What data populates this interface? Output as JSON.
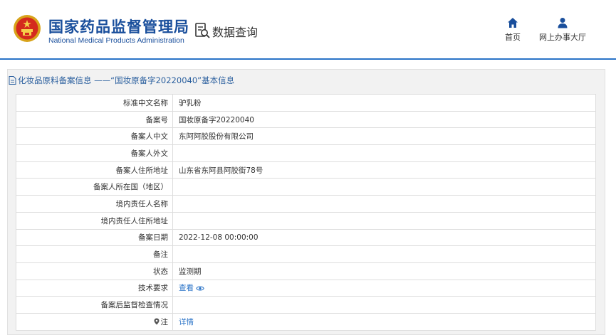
{
  "header": {
    "brand_cn": "国家药品监督管理局",
    "brand_en": "National Medical Products Administration",
    "query_label": "数据查询",
    "nav": [
      {
        "label": "首页",
        "icon": "home-icon"
      },
      {
        "label": "网上办事大厅",
        "icon": "user-icon"
      }
    ],
    "accent_color": "#2a73c7"
  },
  "panel": {
    "title": "化妆品原料备案信息 ——“国妆原备字20220040”基本信息",
    "rows": [
      {
        "label": "标准中文名称",
        "value": "驴乳粉"
      },
      {
        "label": "备案号",
        "value": "国妆原备字20220040"
      },
      {
        "label": "备案人中文",
        "value": "东阿阿胶股份有限公司"
      },
      {
        "label": "备案人外文",
        "value": ""
      },
      {
        "label": "备案人住所地址",
        "value": "山东省东阿县阿胶街78号"
      },
      {
        "label": "备案人所在国（地区）",
        "value": ""
      },
      {
        "label": "境内责任人名称",
        "value": ""
      },
      {
        "label": "境内责任人住所地址",
        "value": ""
      },
      {
        "label": "备案日期",
        "value": "2022-12-08 00:00:00"
      },
      {
        "label": "备注",
        "value": ""
      },
      {
        "label": "状态",
        "value": "监测期"
      },
      {
        "label": "技术要求",
        "value": "查看"
      },
      {
        "label": "备案后监督检查情况",
        "value": ""
      },
      {
        "label": "注",
        "value": "详情"
      }
    ]
  }
}
